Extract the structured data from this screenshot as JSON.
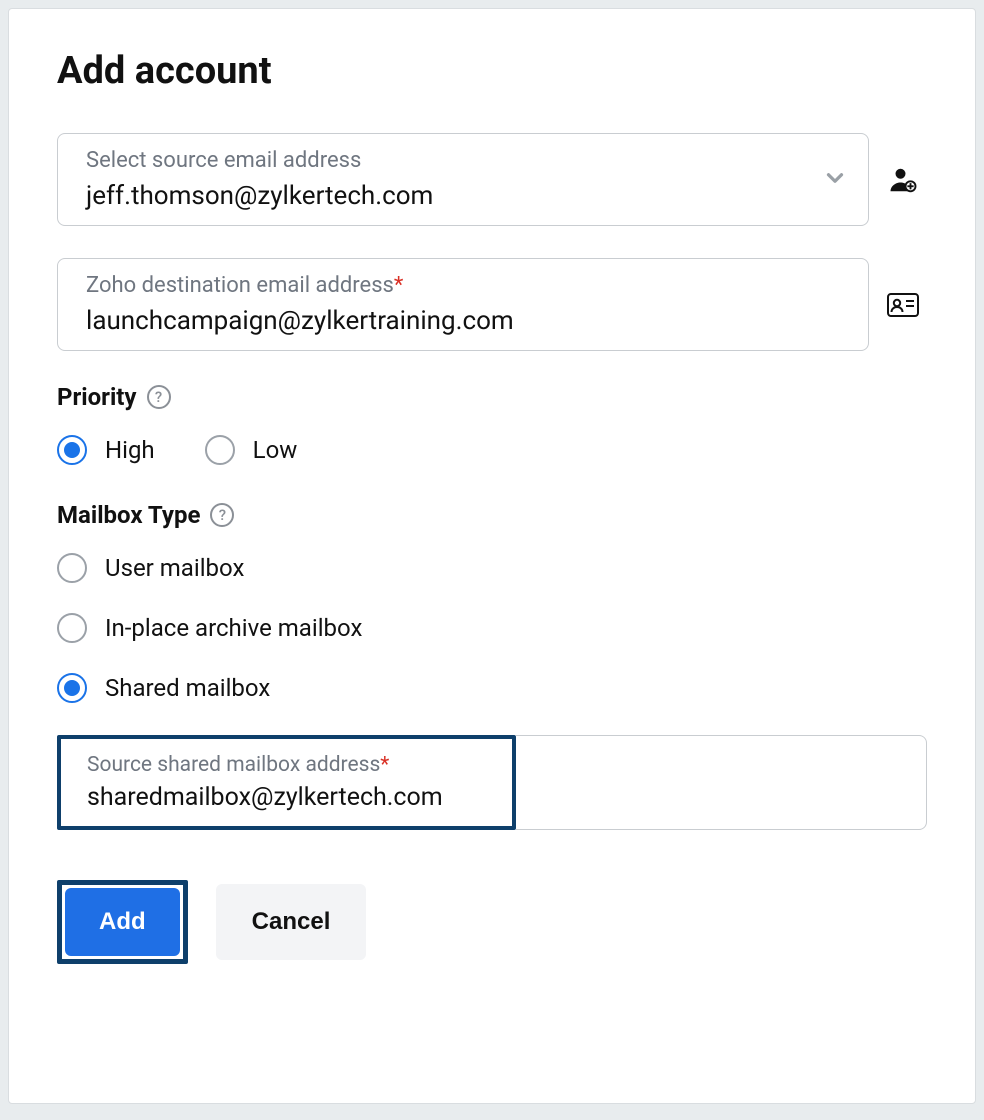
{
  "title": "Add account",
  "source": {
    "label": "Select source email address",
    "value": "jeff.thomson@zylkertech.com"
  },
  "destination": {
    "label": "Zoho destination email address",
    "required_mark": "*",
    "value": "launchcampaign@zylkertraining.com"
  },
  "priority": {
    "label": "Priority",
    "options": {
      "high": "High",
      "low": "Low"
    },
    "selected": "high"
  },
  "mailbox_type": {
    "label": "Mailbox Type",
    "options": {
      "user": "User mailbox",
      "archive": "In-place archive mailbox",
      "shared": "Shared mailbox"
    },
    "selected": "shared"
  },
  "shared_source": {
    "label": "Source shared mailbox address",
    "required_mark": "*",
    "value": "sharedmailbox@zylkertech.com"
  },
  "buttons": {
    "add": "Add",
    "cancel": "Cancel"
  },
  "help_glyph": "?"
}
